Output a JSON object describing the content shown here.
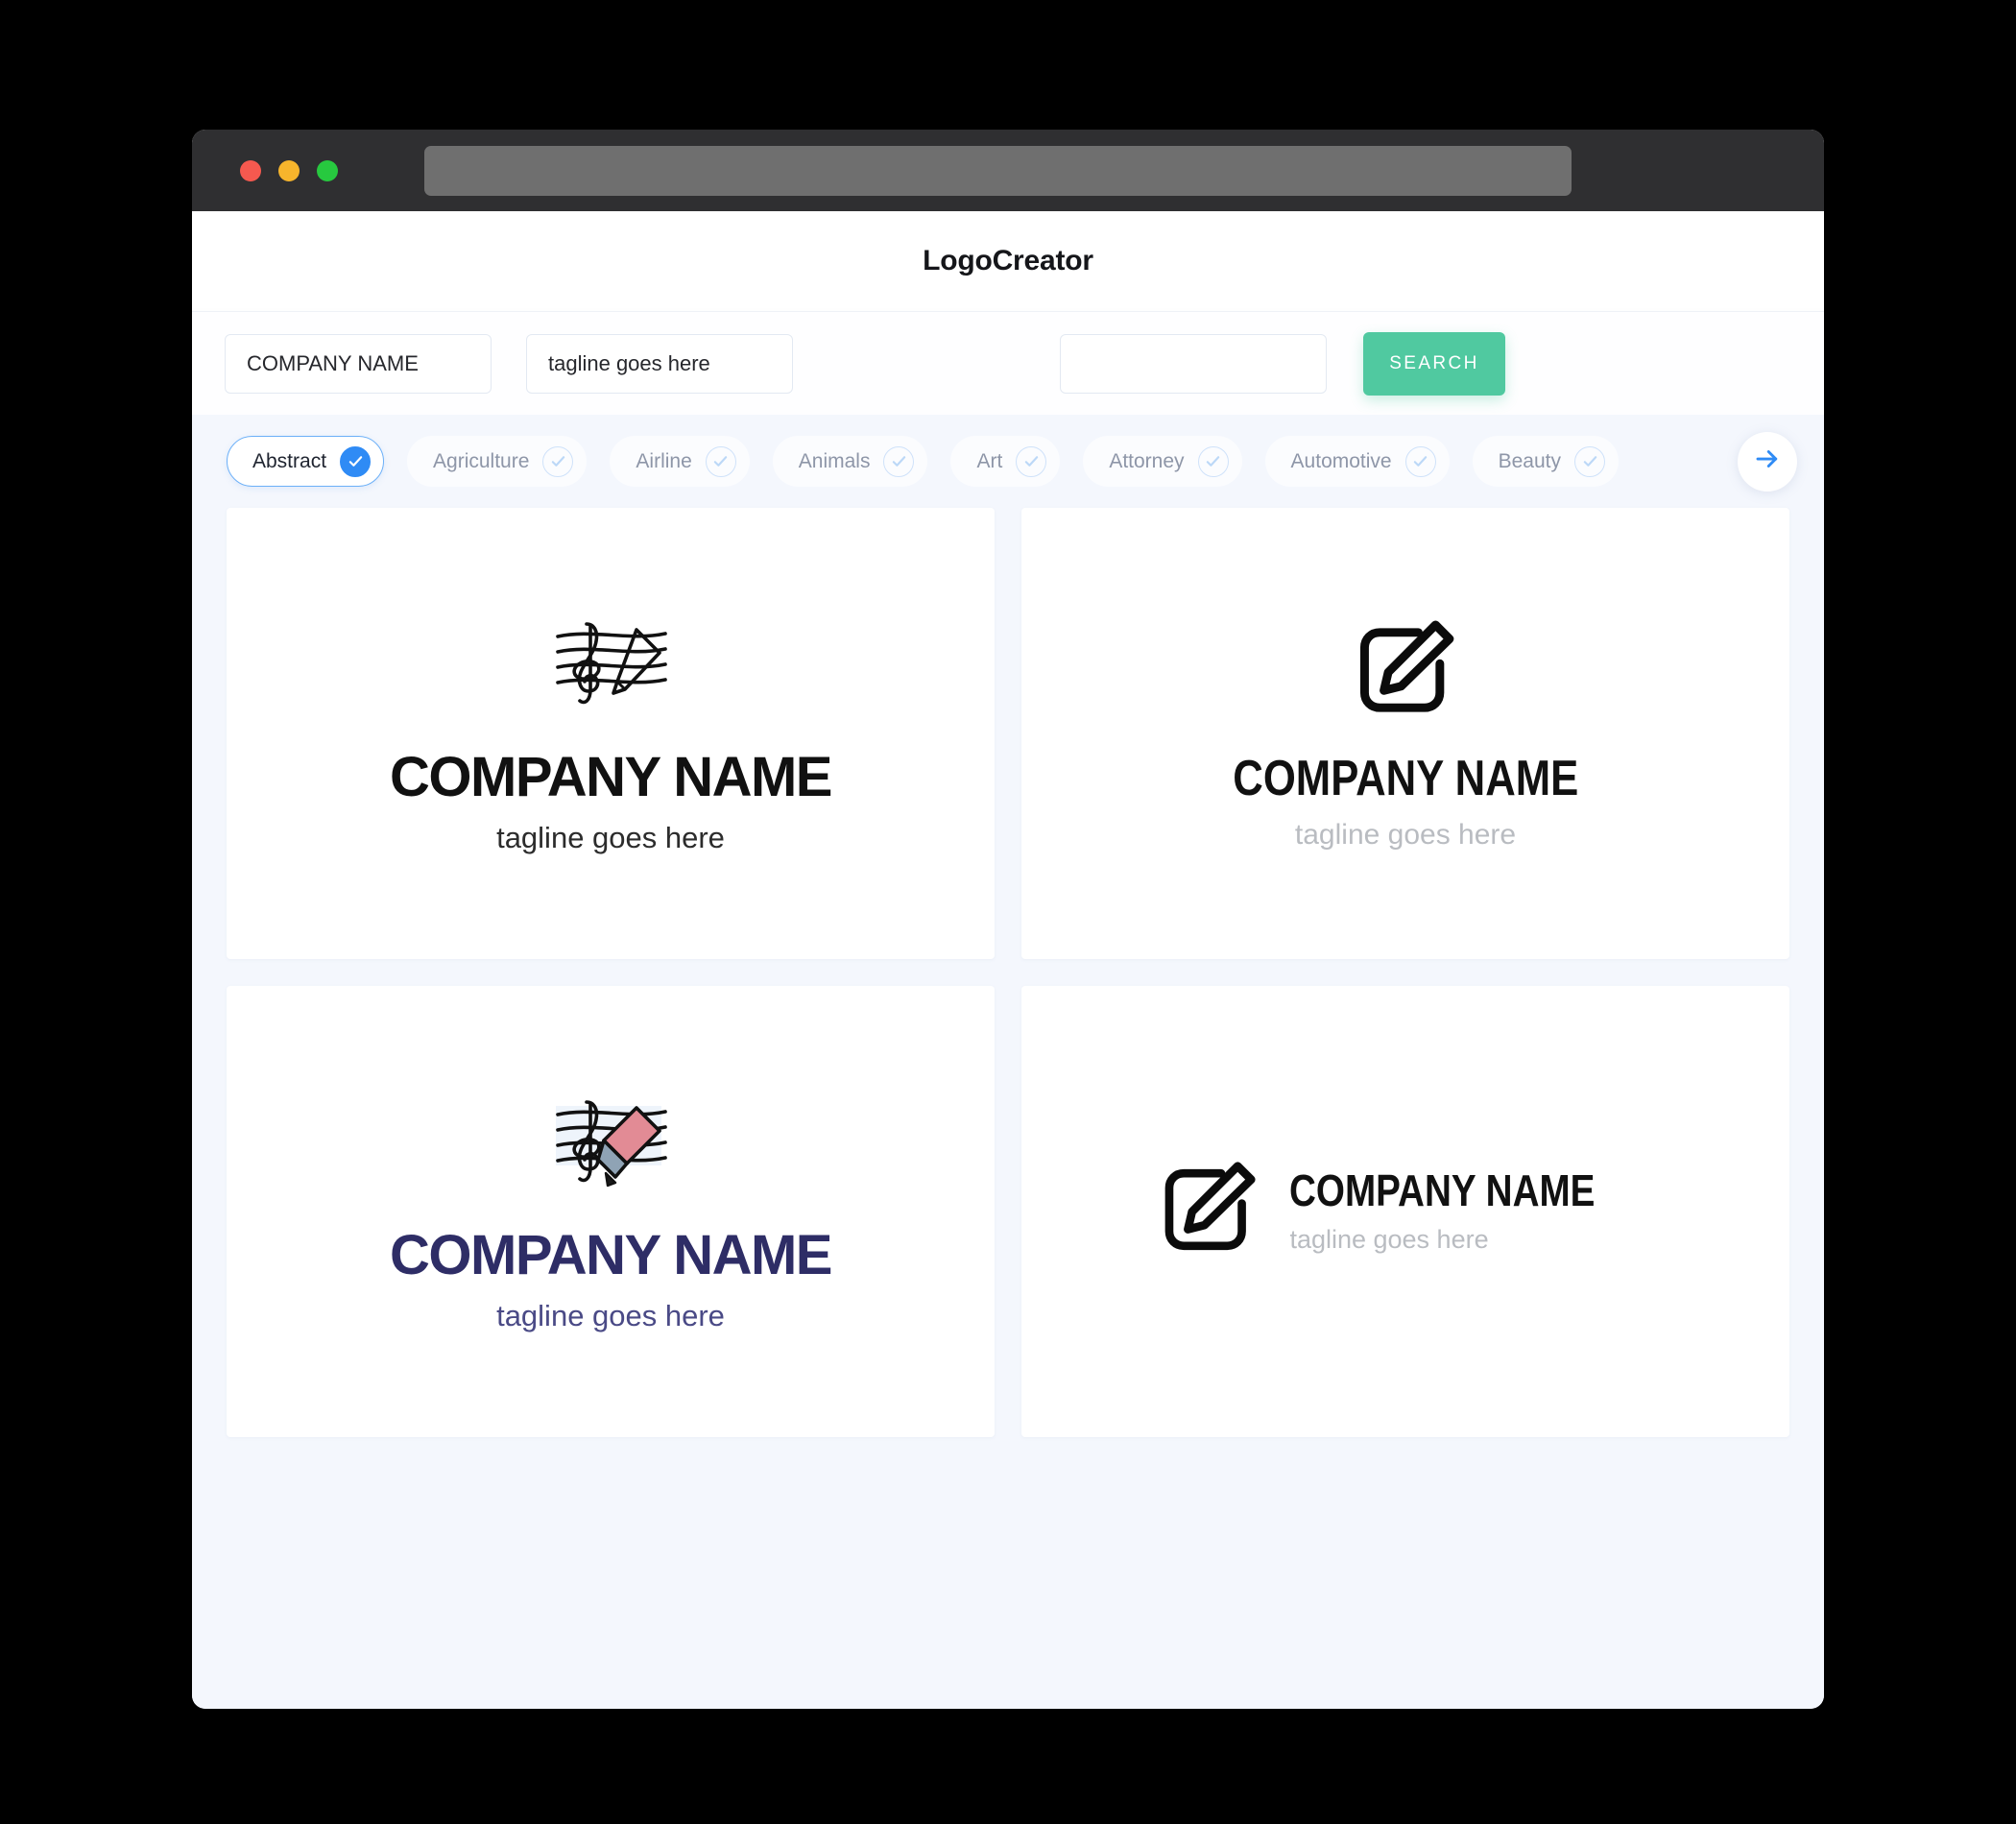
{
  "window": {
    "traffic_lights": [
      {
        "name": "close",
        "color": "#f6594f"
      },
      {
        "name": "minimize",
        "color": "#f7b52c"
      },
      {
        "name": "maximize",
        "color": "#27c93f"
      }
    ],
    "url_value": ""
  },
  "header": {
    "brand_title": "LogoCreator"
  },
  "search": {
    "company_name_value": "COMPANY NAME",
    "company_name_placeholder": "COMPANY NAME",
    "tagline_value": "tagline goes here",
    "tagline_placeholder": "tagline goes here",
    "keyword_value": "",
    "keyword_placeholder": "",
    "search_label": "SEARCH",
    "search_button_color": "#50c9a0"
  },
  "filters": {
    "accent_color": "#2f8bf5",
    "next_icon": "arrow-right-icon",
    "chips": [
      {
        "label": "Abstract",
        "selected": true
      },
      {
        "label": "Agriculture",
        "selected": false
      },
      {
        "label": "Airline",
        "selected": false
      },
      {
        "label": "Animals",
        "selected": false
      },
      {
        "label": "Art",
        "selected": false
      },
      {
        "label": "Attorney",
        "selected": false
      },
      {
        "label": "Automotive",
        "selected": false
      },
      {
        "label": "Beauty",
        "selected": false
      }
    ]
  },
  "results": {
    "cards": [
      {
        "icon": "music-staff-pen-icon",
        "name": "COMPANY NAME",
        "tagline": "tagline goes here",
        "name_color": "#111111",
        "tagline_color": "#2c2c2c",
        "layout": "stacked"
      },
      {
        "icon": "edit-square-pencil-icon",
        "name": "COMPANY NAME",
        "tagline": "tagline goes here",
        "name_color": "#111111",
        "tagline_color": "#b9bcc1",
        "layout": "stacked"
      },
      {
        "icon": "music-staff-pen-color-icon",
        "name": "COMPANY NAME",
        "tagline": "tagline goes here",
        "name_color": "#2e2d66",
        "tagline_color": "#4a4a86",
        "layout": "stacked"
      },
      {
        "icon": "edit-square-pencil-icon",
        "name": "COMPANY NAME",
        "tagline": "tagline goes here",
        "name_color": "#111111",
        "tagline_color": "#b9bcc1",
        "layout": "inline"
      }
    ]
  }
}
